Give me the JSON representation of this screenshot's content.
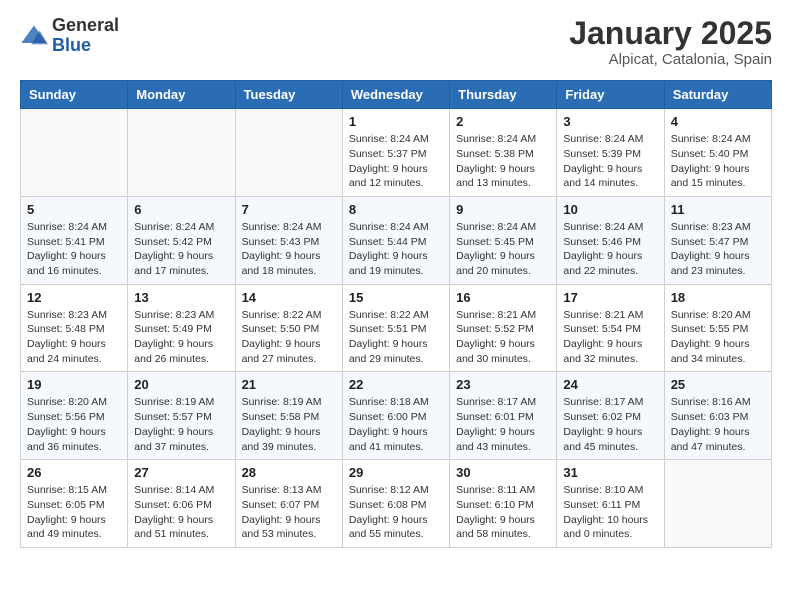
{
  "logo": {
    "general": "General",
    "blue": "Blue"
  },
  "title": "January 2025",
  "location": "Alpicat, Catalonia, Spain",
  "days_of_week": [
    "Sunday",
    "Monday",
    "Tuesday",
    "Wednesday",
    "Thursday",
    "Friday",
    "Saturday"
  ],
  "weeks": [
    [
      {
        "day": "",
        "info": ""
      },
      {
        "day": "",
        "info": ""
      },
      {
        "day": "",
        "info": ""
      },
      {
        "day": "1",
        "info": "Sunrise: 8:24 AM\nSunset: 5:37 PM\nDaylight: 9 hours and 12 minutes."
      },
      {
        "day": "2",
        "info": "Sunrise: 8:24 AM\nSunset: 5:38 PM\nDaylight: 9 hours and 13 minutes."
      },
      {
        "day": "3",
        "info": "Sunrise: 8:24 AM\nSunset: 5:39 PM\nDaylight: 9 hours and 14 minutes."
      },
      {
        "day": "4",
        "info": "Sunrise: 8:24 AM\nSunset: 5:40 PM\nDaylight: 9 hours and 15 minutes."
      }
    ],
    [
      {
        "day": "5",
        "info": "Sunrise: 8:24 AM\nSunset: 5:41 PM\nDaylight: 9 hours and 16 minutes."
      },
      {
        "day": "6",
        "info": "Sunrise: 8:24 AM\nSunset: 5:42 PM\nDaylight: 9 hours and 17 minutes."
      },
      {
        "day": "7",
        "info": "Sunrise: 8:24 AM\nSunset: 5:43 PM\nDaylight: 9 hours and 18 minutes."
      },
      {
        "day": "8",
        "info": "Sunrise: 8:24 AM\nSunset: 5:44 PM\nDaylight: 9 hours and 19 minutes."
      },
      {
        "day": "9",
        "info": "Sunrise: 8:24 AM\nSunset: 5:45 PM\nDaylight: 9 hours and 20 minutes."
      },
      {
        "day": "10",
        "info": "Sunrise: 8:24 AM\nSunset: 5:46 PM\nDaylight: 9 hours and 22 minutes."
      },
      {
        "day": "11",
        "info": "Sunrise: 8:23 AM\nSunset: 5:47 PM\nDaylight: 9 hours and 23 minutes."
      }
    ],
    [
      {
        "day": "12",
        "info": "Sunrise: 8:23 AM\nSunset: 5:48 PM\nDaylight: 9 hours and 24 minutes."
      },
      {
        "day": "13",
        "info": "Sunrise: 8:23 AM\nSunset: 5:49 PM\nDaylight: 9 hours and 26 minutes."
      },
      {
        "day": "14",
        "info": "Sunrise: 8:22 AM\nSunset: 5:50 PM\nDaylight: 9 hours and 27 minutes."
      },
      {
        "day": "15",
        "info": "Sunrise: 8:22 AM\nSunset: 5:51 PM\nDaylight: 9 hours and 29 minutes."
      },
      {
        "day": "16",
        "info": "Sunrise: 8:21 AM\nSunset: 5:52 PM\nDaylight: 9 hours and 30 minutes."
      },
      {
        "day": "17",
        "info": "Sunrise: 8:21 AM\nSunset: 5:54 PM\nDaylight: 9 hours and 32 minutes."
      },
      {
        "day": "18",
        "info": "Sunrise: 8:20 AM\nSunset: 5:55 PM\nDaylight: 9 hours and 34 minutes."
      }
    ],
    [
      {
        "day": "19",
        "info": "Sunrise: 8:20 AM\nSunset: 5:56 PM\nDaylight: 9 hours and 36 minutes."
      },
      {
        "day": "20",
        "info": "Sunrise: 8:19 AM\nSunset: 5:57 PM\nDaylight: 9 hours and 37 minutes."
      },
      {
        "day": "21",
        "info": "Sunrise: 8:19 AM\nSunset: 5:58 PM\nDaylight: 9 hours and 39 minutes."
      },
      {
        "day": "22",
        "info": "Sunrise: 8:18 AM\nSunset: 6:00 PM\nDaylight: 9 hours and 41 minutes."
      },
      {
        "day": "23",
        "info": "Sunrise: 8:17 AM\nSunset: 6:01 PM\nDaylight: 9 hours and 43 minutes."
      },
      {
        "day": "24",
        "info": "Sunrise: 8:17 AM\nSunset: 6:02 PM\nDaylight: 9 hours and 45 minutes."
      },
      {
        "day": "25",
        "info": "Sunrise: 8:16 AM\nSunset: 6:03 PM\nDaylight: 9 hours and 47 minutes."
      }
    ],
    [
      {
        "day": "26",
        "info": "Sunrise: 8:15 AM\nSunset: 6:05 PM\nDaylight: 9 hours and 49 minutes."
      },
      {
        "day": "27",
        "info": "Sunrise: 8:14 AM\nSunset: 6:06 PM\nDaylight: 9 hours and 51 minutes."
      },
      {
        "day": "28",
        "info": "Sunrise: 8:13 AM\nSunset: 6:07 PM\nDaylight: 9 hours and 53 minutes."
      },
      {
        "day": "29",
        "info": "Sunrise: 8:12 AM\nSunset: 6:08 PM\nDaylight: 9 hours and 55 minutes."
      },
      {
        "day": "30",
        "info": "Sunrise: 8:11 AM\nSunset: 6:10 PM\nDaylight: 9 hours and 58 minutes."
      },
      {
        "day": "31",
        "info": "Sunrise: 8:10 AM\nSunset: 6:11 PM\nDaylight: 10 hours and 0 minutes."
      },
      {
        "day": "",
        "info": ""
      }
    ]
  ]
}
